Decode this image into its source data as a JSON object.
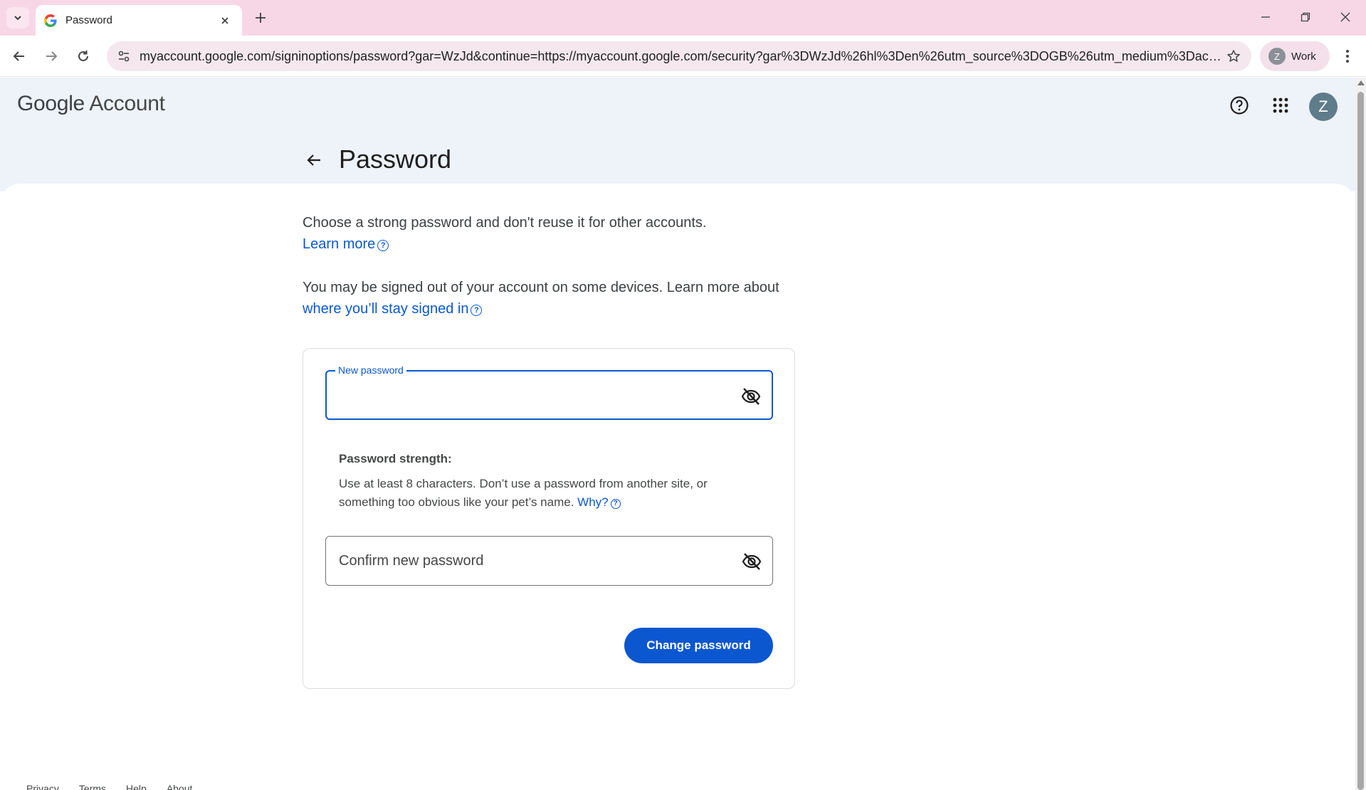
{
  "browser": {
    "tab_title": "Password",
    "url": "myaccount.google.com/signinoptions/password?gar=WzJd&continue=https://myaccount.google.com/security?gar%3DWzJd%26hl%3Den%26utm_source%3DOGB%26utm_medium%3Dact&pli...",
    "profile_initial": "Z",
    "profile_label": "Work"
  },
  "header": {
    "logo_google": "Google",
    "logo_account": "Account",
    "avatar_initial": "Z"
  },
  "page": {
    "title": "Password",
    "intro_text": "Choose a strong password and don't reuse it for other accounts.",
    "intro_link": "Learn more",
    "signout_text": "You may be signed out of your account on some devices. Learn more about",
    "signout_link": "where you’ll stay signed in",
    "help_glyph": "?"
  },
  "form": {
    "new_password_label": "New password",
    "new_password_value": "",
    "strength_title": "Password strength:",
    "strength_text": "Use at least 8 characters. Don’t use a password from another site, or something too obvious like your pet’s name.",
    "strength_link": "Why?",
    "confirm_placeholder": "Confirm new password",
    "submit_label": "Change password"
  },
  "footer": {
    "links": [
      "Privacy",
      "Terms",
      "Help",
      "About"
    ]
  },
  "colors": {
    "accent": "#0b57d0",
    "tabbar": "#f7d7e6",
    "header_bg": "#eef2f9"
  }
}
